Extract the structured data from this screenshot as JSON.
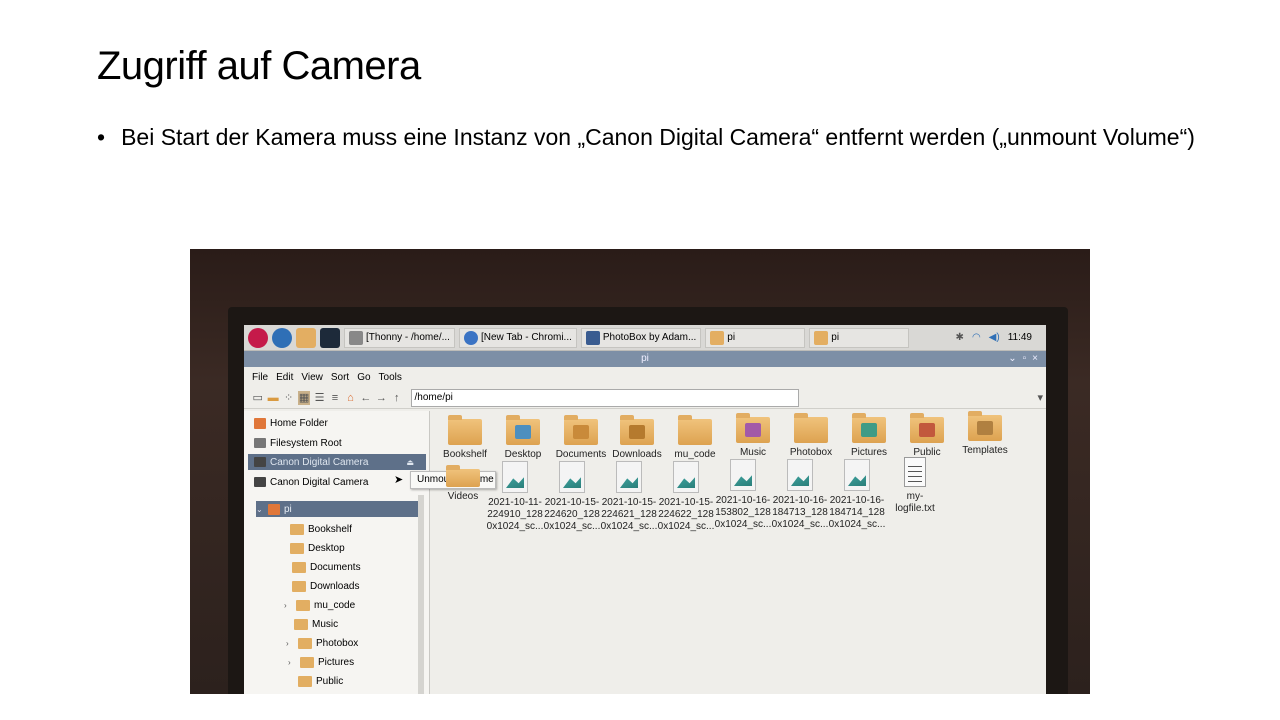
{
  "slide": {
    "title": "Zugriff auf Camera",
    "bullet": "Bei Start der Kamera muss eine Instanz von „Canon Digital Camera“ entfernt werden („unmount Volume“)"
  },
  "taskbar": {
    "tasks": [
      "[Thonny - /home/...",
      "[New Tab - Chromi...",
      "PhotoBox by Adam...",
      "pi",
      "pi"
    ],
    "clock": "11:49"
  },
  "window": {
    "title": "pi",
    "menu": [
      "File",
      "Edit",
      "View",
      "Sort",
      "Go",
      "Tools"
    ],
    "address": "/home/pi"
  },
  "sidebar": {
    "places": [
      "Home Folder",
      "Filesystem Root",
      "Canon Digital Camera",
      "Canon Digital Camera"
    ],
    "context_menu": "Unmount Volume",
    "tree": [
      "pi",
      "Bookshelf",
      "Desktop",
      "Documents",
      "Downloads",
      "mu_code",
      "Music",
      "Photobox",
      "Pictures",
      "Public"
    ]
  },
  "files": {
    "folders": [
      "Bookshelf",
      "Desktop",
      "Documents",
      "Downloads",
      "mu_code",
      "Music",
      "Photobox",
      "Pictures",
      "Public",
      "Templates",
      "Videos"
    ],
    "images": [
      {
        "l1": "2021-10-11-",
        "l2": "224910_128",
        "l3": "0x1024_sc..."
      },
      {
        "l1": "2021-10-15-",
        "l2": "224620_128",
        "l3": "0x1024_sc..."
      },
      {
        "l1": "2021-10-15-",
        "l2": "224621_128",
        "l3": "0x1024_sc..."
      },
      {
        "l1": "2021-10-15-",
        "l2": "224622_128",
        "l3": "0x1024_sc..."
      },
      {
        "l1": "2021-10-16-",
        "l2": "153802_128",
        "l3": "0x1024_sc..."
      },
      {
        "l1": "2021-10-16-",
        "l2": "184713_128",
        "l3": "0x1024_sc..."
      },
      {
        "l1": "2021-10-16-",
        "l2": "184714_128",
        "l3": "0x1024_sc..."
      }
    ],
    "text_file": {
      "l1": "my-",
      "l2": "logfile.txt"
    }
  },
  "icons": {
    "raspberry": "raspberry-icon",
    "globe": "globe-icon",
    "folders": "folders-icon",
    "terminal": "terminal-icon",
    "bluetooth": "bluetooth-icon",
    "wifi": "wifi-icon",
    "volume": "volume-icon",
    "eject": "eject-icon"
  }
}
